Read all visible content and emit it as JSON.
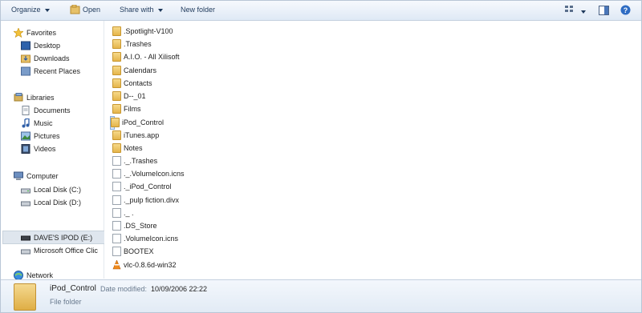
{
  "toolbar": {
    "organize": "Organize",
    "open": "Open",
    "share_with": "Share with",
    "new_folder": "New folder",
    "icons": [
      "open-icon",
      "view-options-icon",
      "preview-pane-icon",
      "help-icon"
    ]
  },
  "nav": {
    "favorites": {
      "label": "Favorites",
      "items": [
        "Desktop",
        "Downloads",
        "Recent Places"
      ]
    },
    "libraries": {
      "label": "Libraries",
      "items": [
        "Documents",
        "Music",
        "Pictures",
        "Videos"
      ]
    },
    "computer": {
      "label": "Computer",
      "items": [
        "Local Disk (C:)",
        "Local Disk (D:)",
        "DAVE'S IPOD (E:)",
        "Microsoft Office Clic"
      ]
    },
    "network": {
      "label": "Network"
    }
  },
  "files": [
    {
      "name": ".Spotlight-V100",
      "type": "folder"
    },
    {
      "name": ".Trashes",
      "type": "folder"
    },
    {
      "name": "A.I.O. - All Xilisoft",
      "type": "folder"
    },
    {
      "name": "Calendars",
      "type": "folder"
    },
    {
      "name": "Contacts",
      "type": "folder"
    },
    {
      "name": "D--_01",
      "type": "folder"
    },
    {
      "name": "Films",
      "type": "folder"
    },
    {
      "name": "iPod_Control",
      "type": "folder",
      "selected": true
    },
    {
      "name": "iTunes.app",
      "type": "folder"
    },
    {
      "name": "Notes",
      "type": "folder"
    },
    {
      "name": "._.Trashes",
      "type": "file"
    },
    {
      "name": "._.VolumeIcon.icns",
      "type": "file"
    },
    {
      "name": "._iPod_Control",
      "type": "file"
    },
    {
      "name": "._pulp fiction.divx",
      "type": "file"
    },
    {
      "name": "._ .",
      "type": "file"
    },
    {
      "name": ".DS_Store",
      "type": "file"
    },
    {
      "name": ".VolumeIcon.icns",
      "type": "file"
    },
    {
      "name": "BOOTEX",
      "type": "file"
    },
    {
      "name": "vlc-0.8.6d-win32",
      "type": "app"
    }
  ],
  "status": {
    "name": "iPod_Control",
    "date_label": "Date modified:",
    "date_value": "10/09/2006 22:22",
    "type": "File folder"
  }
}
